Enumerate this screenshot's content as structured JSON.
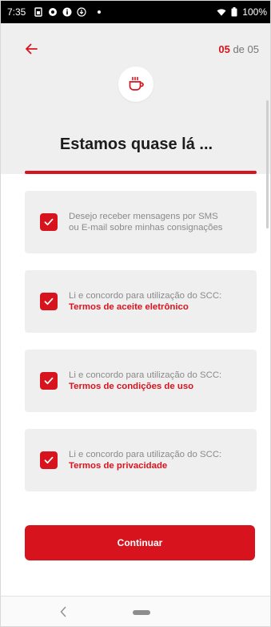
{
  "status_bar": {
    "time": "7:35",
    "battery": "100%",
    "icons": [
      "sim-icon",
      "record-icon",
      "info-icon",
      "download-icon",
      "wifi-icon",
      "battery-icon"
    ]
  },
  "header": {
    "step_current": "05",
    "step_sep": " de ",
    "step_total": "05",
    "title": "Estamos quase lá ...",
    "icon": "coffee-cup-icon"
  },
  "consents": [
    {
      "checked": true,
      "text": "Desejo receber mensagens por SMS ou E-mail sobre minhas consignações",
      "term": ""
    },
    {
      "checked": true,
      "text": "Li e concordo para utilização do SCC:",
      "term": "Termos de aceite eletrônico"
    },
    {
      "checked": true,
      "text": "Li e concordo para utilização do SCC:",
      "term": "Termos de condições de uso"
    },
    {
      "checked": true,
      "text": "Li e concordo para utilização do SCC:",
      "term": "Termos de privacidade"
    }
  ],
  "continue_label": "Continuar",
  "colors": {
    "accent": "#d7141e",
    "background": "#efefef"
  }
}
